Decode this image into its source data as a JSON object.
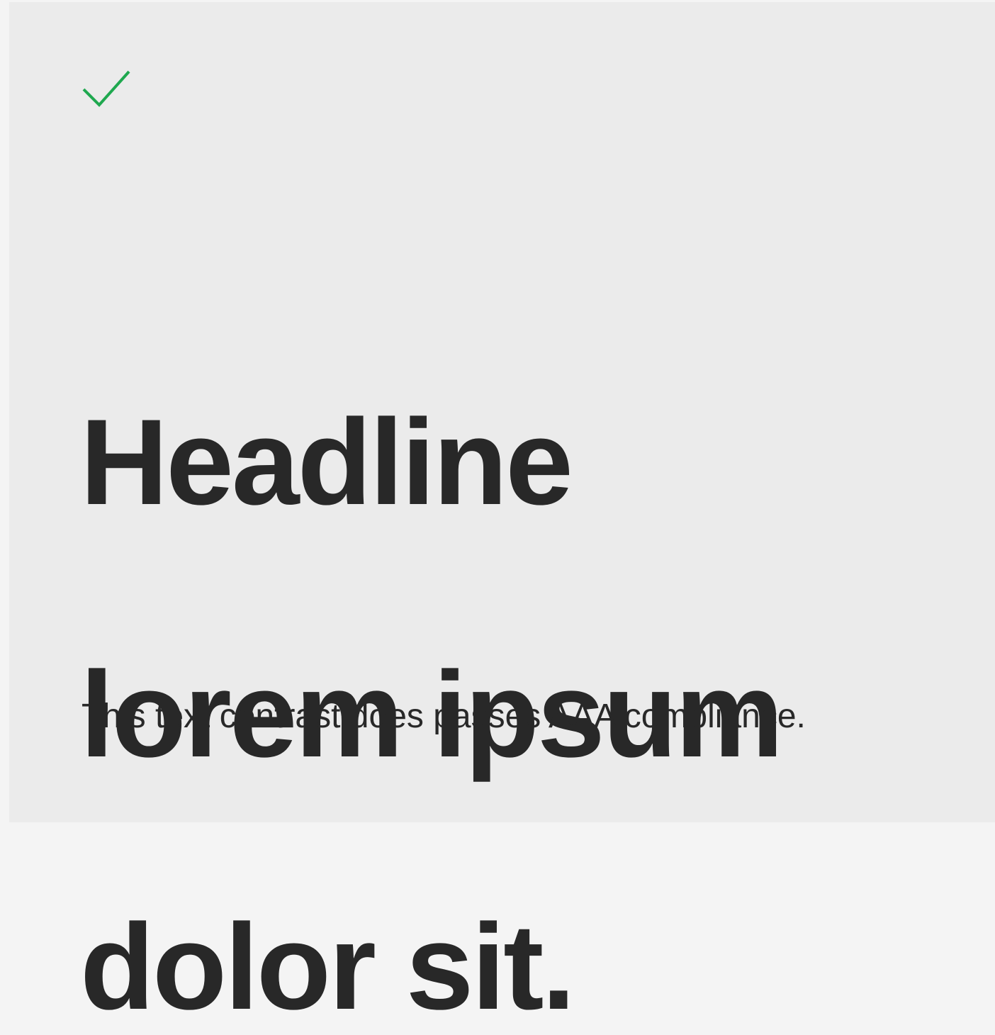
{
  "card": {
    "headline_lines": [
      "Headline",
      "lorem ipsum",
      "dolor sit."
    ],
    "body": "This text contrast does passes AAA compliance.",
    "status_icon": "check-icon",
    "status_color": "#1fa84f"
  },
  "colors": {
    "background": "#ebebeb",
    "text": "#282828"
  }
}
